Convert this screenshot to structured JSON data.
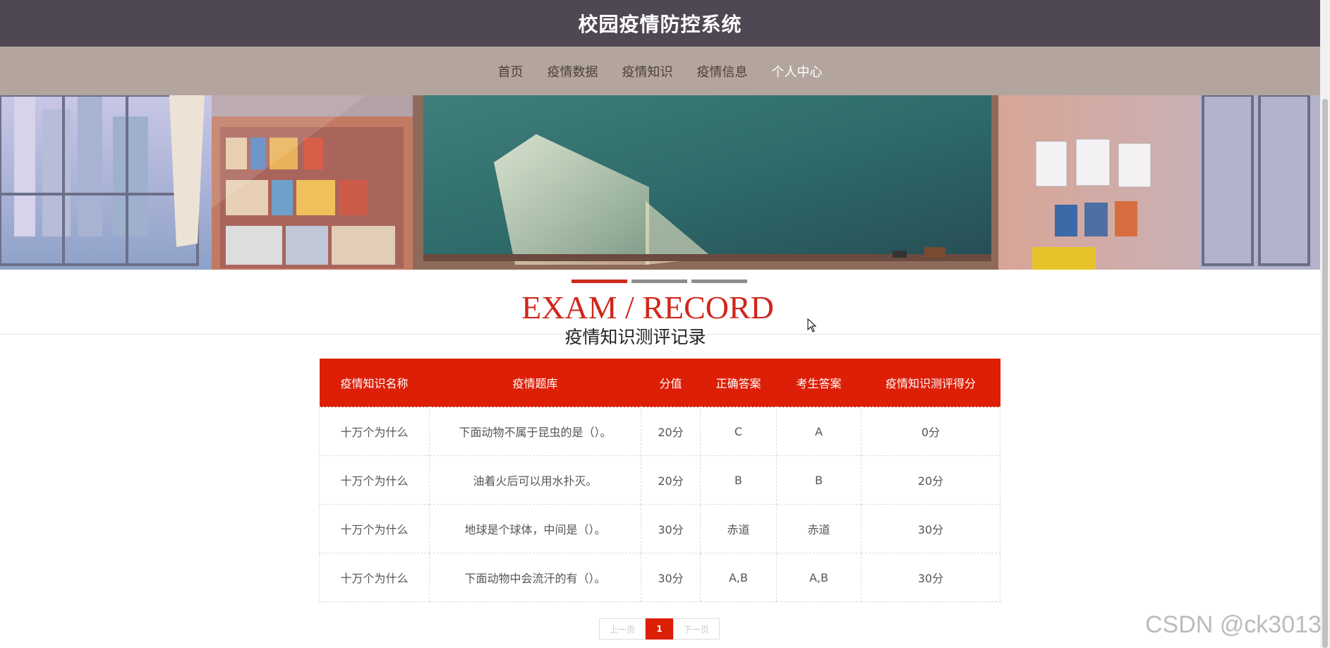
{
  "header": {
    "title": "校园疫情防控系统"
  },
  "nav": {
    "items": [
      {
        "label": "首页"
      },
      {
        "label": "疫情数据"
      },
      {
        "label": "疫情知识"
      },
      {
        "label": "疫情信息"
      },
      {
        "label": "个人中心"
      }
    ],
    "active_index": 4
  },
  "section": {
    "title_en": "EXAM / RECORD",
    "title_cn": "疫情知识测评记录"
  },
  "table": {
    "headers": [
      "疫情知识名称",
      "疫情题库",
      "分值",
      "正确答案",
      "考生答案",
      "疫情知识测评得分"
    ],
    "rows": [
      [
        "十万个为什么",
        "下面动物不属于昆虫的是（）。",
        "20分",
        "C",
        "A",
        "0分"
      ],
      [
        "十万个为什么",
        "油着火后可以用水扑灭。",
        "20分",
        "B",
        "B",
        "20分"
      ],
      [
        "十万个为什么",
        "地球是个球体，中间是（）。",
        "30分",
        "赤道",
        "赤道",
        "30分"
      ],
      [
        "十万个为什么",
        "下面动物中会流汗的有（）。",
        "30分",
        "A,B",
        "A,B",
        "30分"
      ]
    ]
  },
  "pager": {
    "prev": "上一页",
    "current": "1",
    "next": "下一页"
  },
  "watermark": "CSDN @ck3013",
  "colors": {
    "accent": "#dd1f07",
    "header_bg": "#4f4854",
    "nav_bg": "#b3a59d"
  }
}
